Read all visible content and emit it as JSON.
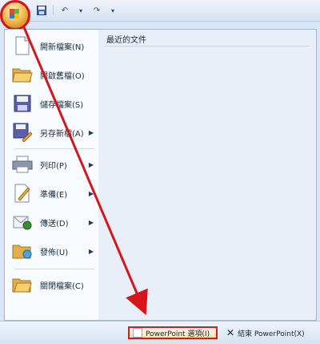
{
  "quick_access_toolbar": {
    "undo_glyph": "↶",
    "redo_glyph": "↷",
    "dropdown_glyph": "▾"
  },
  "menu": {
    "items": [
      {
        "label": "開新檔案(N)",
        "has_submenu": false,
        "icon": "new-file-icon"
      },
      {
        "label": "開啟舊檔(O)",
        "has_submenu": false,
        "icon": "open-folder-icon"
      },
      {
        "label": "儲存檔案(S)",
        "has_submenu": false,
        "icon": "save-icon"
      },
      {
        "label": "另存新檔(A)",
        "has_submenu": true,
        "icon": "save-as-icon"
      },
      {
        "label": "列印(P)",
        "has_submenu": true,
        "icon": "print-icon"
      },
      {
        "label": "準備(E)",
        "has_submenu": true,
        "icon": "prepare-icon"
      },
      {
        "label": "傳送(D)",
        "has_submenu": true,
        "icon": "send-icon"
      },
      {
        "label": "發佈(U)",
        "has_submenu": true,
        "icon": "publish-icon"
      },
      {
        "label": "關閉檔案(C)",
        "has_submenu": false,
        "icon": "close-file-icon"
      }
    ],
    "recent_title": "最近的文件",
    "submenu_arrow": "▶"
  },
  "bottom": {
    "options_label": "PowerPoint 選項(I)",
    "exit_label": "結束 PowerPoint(X)",
    "exit_glyph": "✕"
  },
  "colors": {
    "callout": "#d6161b"
  }
}
